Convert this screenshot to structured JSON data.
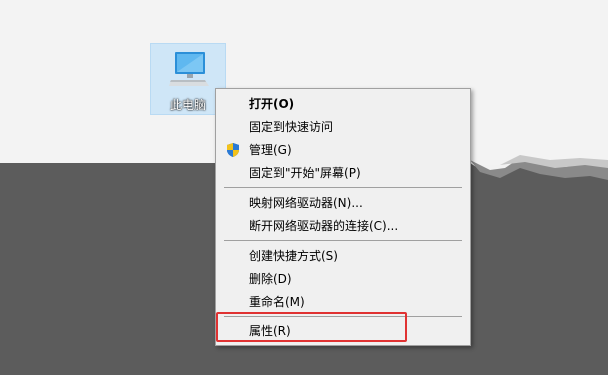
{
  "desktop": {
    "icon_label": "此电脑"
  },
  "context_menu": {
    "items": [
      {
        "label": "打开(O)",
        "bold": true
      },
      {
        "label": "固定到快速访问"
      },
      {
        "label": "管理(G)",
        "icon": "uac-shield-icon"
      },
      {
        "label": "固定到\"开始\"屏幕(P)"
      },
      {
        "label": "映射网络驱动器(N)..."
      },
      {
        "label": "断开网络驱动器的连接(C)..."
      },
      {
        "label": "创建快捷方式(S)"
      },
      {
        "label": "删除(D)"
      },
      {
        "label": "重命名(M)"
      },
      {
        "label": "属性(R)"
      }
    ]
  },
  "colors": {
    "highlight_border": "#e03232",
    "desktop_dark": "#5c5c5c",
    "menu_bg": "#f0f0f0"
  }
}
